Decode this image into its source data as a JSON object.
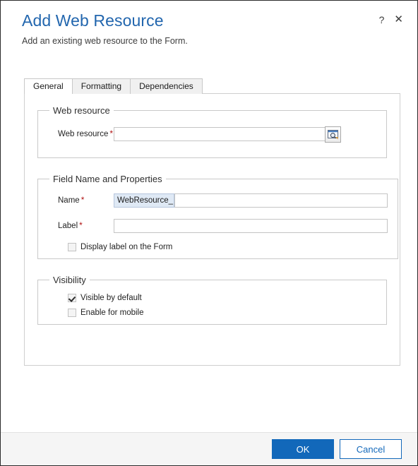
{
  "header": {
    "title": "Add Web Resource",
    "subtitle": "Add an existing web resource to the Form.",
    "help_label": "?",
    "close_label": "✕"
  },
  "tabs": [
    {
      "label": "General",
      "active": true
    },
    {
      "label": "Formatting",
      "active": false
    },
    {
      "label": "Dependencies",
      "active": false
    }
  ],
  "web_resource_group": {
    "legend": "Web resource",
    "field_label": "Web resource",
    "required_mark": "*",
    "value": "",
    "placeholder": "",
    "lookup_icon": "browse-lookup-icon"
  },
  "field_group": {
    "legend": "Field Name and Properties",
    "name_label": "Name",
    "name_required_mark": "*",
    "name_prefix": "WebResource_",
    "name_value": "",
    "label_label": "Label",
    "label_required_mark": "*",
    "label_value": "",
    "display_label_checkbox": "Display label on the Form",
    "display_label_checked": false
  },
  "visibility_group": {
    "legend": "Visibility",
    "visible_by_default_label": "Visible by default",
    "visible_by_default_checked": true,
    "enable_for_mobile_label": "Enable for mobile",
    "enable_for_mobile_checked": false
  },
  "footer": {
    "ok_label": "OK",
    "cancel_label": "Cancel"
  },
  "colors": {
    "title_blue": "#2266ae",
    "accent_blue": "#1268ba",
    "required_red": "#b01212",
    "prefix_bg": "#dfe9f5",
    "footer_bg": "#f5f5f5"
  }
}
